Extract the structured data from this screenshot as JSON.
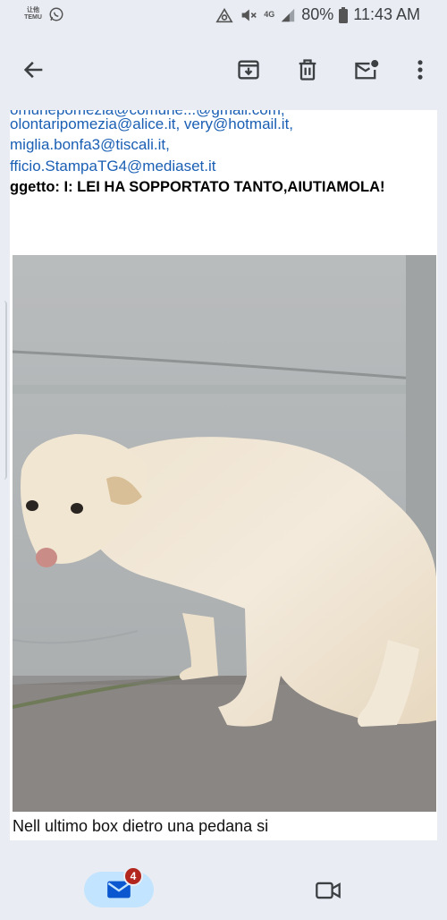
{
  "status_bar": {
    "left_app_label": "TEMU",
    "left_app_sub": "让他",
    "network_label": "4G",
    "battery": "80%",
    "time": "11:43 AM"
  },
  "email": {
    "header_lines": [
      "omunepomezia@comune...@gmail.com,",
      "olontaripomezia@alice.it, very@hotmail.it,",
      "miglia.bonfa3@tiscali.it,",
      "fficio.StampaTG4@mediaset.it"
    ],
    "subject": "ggetto: I: LEI HA SOPPORTATO TANTO,AIUTIAMOLA!",
    "body_start": "Nell ultimo box dietro una pedana si"
  },
  "bottom_nav": {
    "mail_badge": "4"
  },
  "colors": {
    "link": "#1a5fb4",
    "background": "#e9edf3",
    "active_tab": "#c2e4ff",
    "badge": "#b3261e"
  },
  "icons": [
    "temu-icon",
    "whatsapp-icon",
    "alarm-icon",
    "mute-icon",
    "signal-icon",
    "battery-icon",
    "back-arrow-icon",
    "archive-icon",
    "delete-icon",
    "mark-unread-icon",
    "more-vert-icon",
    "mail-icon",
    "video-icon"
  ]
}
